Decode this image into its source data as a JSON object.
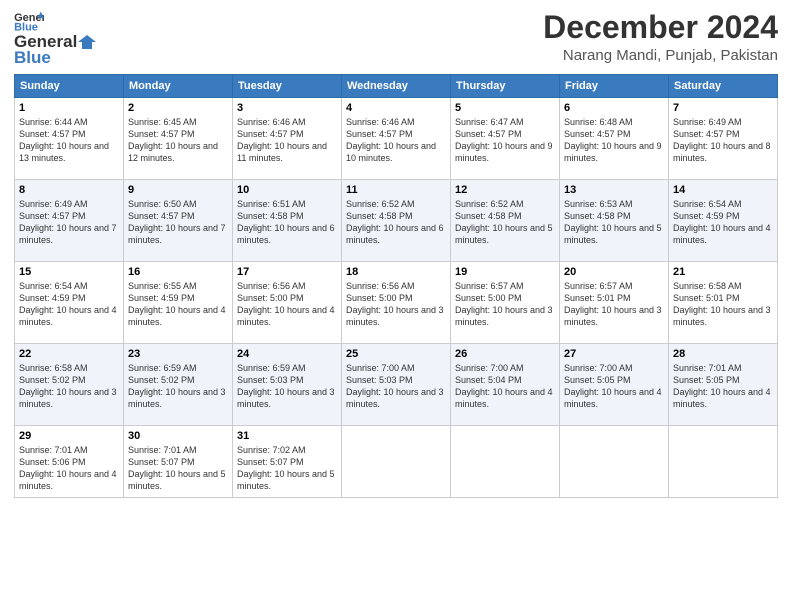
{
  "logo": {
    "general": "General",
    "blue": "Blue"
  },
  "title": "December 2024",
  "location": "Narang Mandi, Punjab, Pakistan",
  "weekdays": [
    "Sunday",
    "Monday",
    "Tuesday",
    "Wednesday",
    "Thursday",
    "Friday",
    "Saturday"
  ],
  "weeks": [
    [
      {
        "day": "1",
        "sunrise": "Sunrise: 6:44 AM",
        "sunset": "Sunset: 4:57 PM",
        "daylight": "Daylight: 10 hours and 13 minutes."
      },
      {
        "day": "2",
        "sunrise": "Sunrise: 6:45 AM",
        "sunset": "Sunset: 4:57 PM",
        "daylight": "Daylight: 10 hours and 12 minutes."
      },
      {
        "day": "3",
        "sunrise": "Sunrise: 6:46 AM",
        "sunset": "Sunset: 4:57 PM",
        "daylight": "Daylight: 10 hours and 11 minutes."
      },
      {
        "day": "4",
        "sunrise": "Sunrise: 6:46 AM",
        "sunset": "Sunset: 4:57 PM",
        "daylight": "Daylight: 10 hours and 10 minutes."
      },
      {
        "day": "5",
        "sunrise": "Sunrise: 6:47 AM",
        "sunset": "Sunset: 4:57 PM",
        "daylight": "Daylight: 10 hours and 9 minutes."
      },
      {
        "day": "6",
        "sunrise": "Sunrise: 6:48 AM",
        "sunset": "Sunset: 4:57 PM",
        "daylight": "Daylight: 10 hours and 9 minutes."
      },
      {
        "day": "7",
        "sunrise": "Sunrise: 6:49 AM",
        "sunset": "Sunset: 4:57 PM",
        "daylight": "Daylight: 10 hours and 8 minutes."
      }
    ],
    [
      {
        "day": "8",
        "sunrise": "Sunrise: 6:49 AM",
        "sunset": "Sunset: 4:57 PM",
        "daylight": "Daylight: 10 hours and 7 minutes."
      },
      {
        "day": "9",
        "sunrise": "Sunrise: 6:50 AM",
        "sunset": "Sunset: 4:57 PM",
        "daylight": "Daylight: 10 hours and 7 minutes."
      },
      {
        "day": "10",
        "sunrise": "Sunrise: 6:51 AM",
        "sunset": "Sunset: 4:58 PM",
        "daylight": "Daylight: 10 hours and 6 minutes."
      },
      {
        "day": "11",
        "sunrise": "Sunrise: 6:52 AM",
        "sunset": "Sunset: 4:58 PM",
        "daylight": "Daylight: 10 hours and 6 minutes."
      },
      {
        "day": "12",
        "sunrise": "Sunrise: 6:52 AM",
        "sunset": "Sunset: 4:58 PM",
        "daylight": "Daylight: 10 hours and 5 minutes."
      },
      {
        "day": "13",
        "sunrise": "Sunrise: 6:53 AM",
        "sunset": "Sunset: 4:58 PM",
        "daylight": "Daylight: 10 hours and 5 minutes."
      },
      {
        "day": "14",
        "sunrise": "Sunrise: 6:54 AM",
        "sunset": "Sunset: 4:59 PM",
        "daylight": "Daylight: 10 hours and 4 minutes."
      }
    ],
    [
      {
        "day": "15",
        "sunrise": "Sunrise: 6:54 AM",
        "sunset": "Sunset: 4:59 PM",
        "daylight": "Daylight: 10 hours and 4 minutes."
      },
      {
        "day": "16",
        "sunrise": "Sunrise: 6:55 AM",
        "sunset": "Sunset: 4:59 PM",
        "daylight": "Daylight: 10 hours and 4 minutes."
      },
      {
        "day": "17",
        "sunrise": "Sunrise: 6:56 AM",
        "sunset": "Sunset: 5:00 PM",
        "daylight": "Daylight: 10 hours and 4 minutes."
      },
      {
        "day": "18",
        "sunrise": "Sunrise: 6:56 AM",
        "sunset": "Sunset: 5:00 PM",
        "daylight": "Daylight: 10 hours and 3 minutes."
      },
      {
        "day": "19",
        "sunrise": "Sunrise: 6:57 AM",
        "sunset": "Sunset: 5:00 PM",
        "daylight": "Daylight: 10 hours and 3 minutes."
      },
      {
        "day": "20",
        "sunrise": "Sunrise: 6:57 AM",
        "sunset": "Sunset: 5:01 PM",
        "daylight": "Daylight: 10 hours and 3 minutes."
      },
      {
        "day": "21",
        "sunrise": "Sunrise: 6:58 AM",
        "sunset": "Sunset: 5:01 PM",
        "daylight": "Daylight: 10 hours and 3 minutes."
      }
    ],
    [
      {
        "day": "22",
        "sunrise": "Sunrise: 6:58 AM",
        "sunset": "Sunset: 5:02 PM",
        "daylight": "Daylight: 10 hours and 3 minutes."
      },
      {
        "day": "23",
        "sunrise": "Sunrise: 6:59 AM",
        "sunset": "Sunset: 5:02 PM",
        "daylight": "Daylight: 10 hours and 3 minutes."
      },
      {
        "day": "24",
        "sunrise": "Sunrise: 6:59 AM",
        "sunset": "Sunset: 5:03 PM",
        "daylight": "Daylight: 10 hours and 3 minutes."
      },
      {
        "day": "25",
        "sunrise": "Sunrise: 7:00 AM",
        "sunset": "Sunset: 5:03 PM",
        "daylight": "Daylight: 10 hours and 3 minutes."
      },
      {
        "day": "26",
        "sunrise": "Sunrise: 7:00 AM",
        "sunset": "Sunset: 5:04 PM",
        "daylight": "Daylight: 10 hours and 4 minutes."
      },
      {
        "day": "27",
        "sunrise": "Sunrise: 7:00 AM",
        "sunset": "Sunset: 5:05 PM",
        "daylight": "Daylight: 10 hours and 4 minutes."
      },
      {
        "day": "28",
        "sunrise": "Sunrise: 7:01 AM",
        "sunset": "Sunset: 5:05 PM",
        "daylight": "Daylight: 10 hours and 4 minutes."
      }
    ],
    [
      {
        "day": "29",
        "sunrise": "Sunrise: 7:01 AM",
        "sunset": "Sunset: 5:06 PM",
        "daylight": "Daylight: 10 hours and 4 minutes."
      },
      {
        "day": "30",
        "sunrise": "Sunrise: 7:01 AM",
        "sunset": "Sunset: 5:07 PM",
        "daylight": "Daylight: 10 hours and 5 minutes."
      },
      {
        "day": "31",
        "sunrise": "Sunrise: 7:02 AM",
        "sunset": "Sunset: 5:07 PM",
        "daylight": "Daylight: 10 hours and 5 minutes."
      },
      null,
      null,
      null,
      null
    ]
  ]
}
